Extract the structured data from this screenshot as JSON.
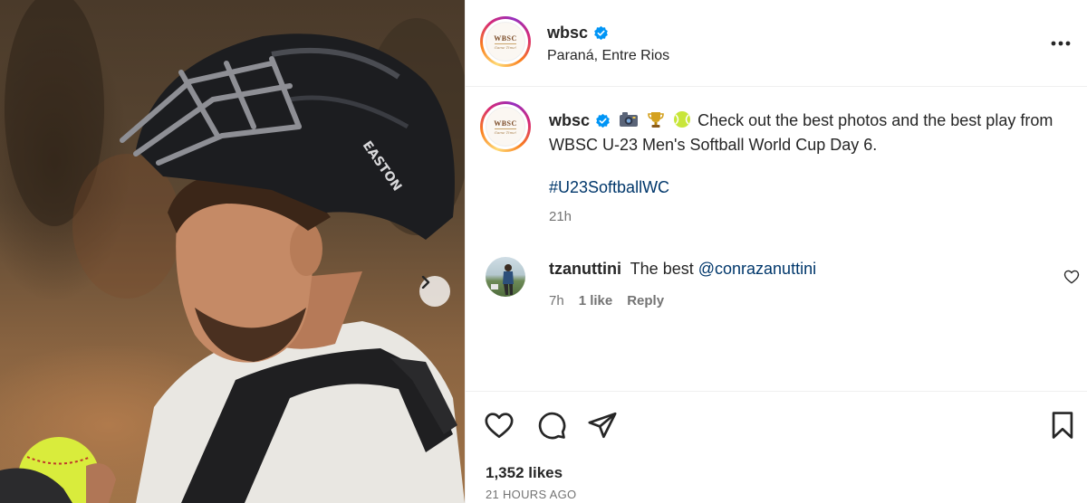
{
  "post": {
    "username": "wbsc",
    "location": "Paraná, Entre Rios",
    "logo_text": "WBSC",
    "logo_subtext": "Game Time!",
    "caption": "Check out the best photos and the best play from WBSC U-23 Men's Softball World Cup Day 6.",
    "caption_emojis": [
      "camera-emoji",
      "trophy-emoji",
      "softball-emoji"
    ],
    "hashtag": "#U23SoftballWC",
    "caption_time": "21h",
    "likes": "1,352 likes",
    "posted_ago": "21 HOURS AGO"
  },
  "comment": {
    "username": "tzanuttini",
    "text": "The best",
    "mention": "@conrazanuttini",
    "time": "7h",
    "likes": "1 like",
    "reply_label": "Reply"
  },
  "icons": {
    "verified": "verified-badge-icon",
    "more": "more-options-icon",
    "next": "chevron-right-icon",
    "like": "heart-icon",
    "comment": "comment-icon",
    "share": "send-icon",
    "save": "bookmark-icon"
  },
  "colors": {
    "verified": "#0095f6",
    "link": "#00376b",
    "secondary_text": "#737373"
  }
}
